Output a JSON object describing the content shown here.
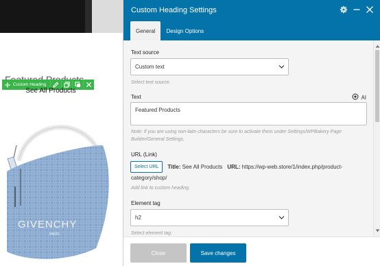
{
  "preview": {
    "heading_text": "Featured Products",
    "sub_text": "See All Products",
    "toolbar_label": "Custom Heading",
    "bag_brand_text": "GIVENCHY",
    "bag_sub_text": "PARIS"
  },
  "panel": {
    "title": "Custom Heading Settings",
    "tabs": [
      {
        "label": "General",
        "active": true
      },
      {
        "label": "Design Options",
        "active": false
      }
    ],
    "header_icons": [
      "gear-icon",
      "minimize-icon",
      "close-icon"
    ]
  },
  "fields": {
    "text_source": {
      "label": "Text source",
      "value": "Custom text",
      "hint": "Select text source."
    },
    "text": {
      "label": "Text",
      "value": "Featured Products",
      "ai_label": "AI",
      "hint_line1": "Note: If you are using non-latin characters be sure to activate them under Settings/WPBakery Page",
      "hint_line2": "Builder/General Settings."
    },
    "url": {
      "label": "URL (Link)",
      "button_label": "Select URL",
      "title_label": "Title:",
      "title_value": "See All Products",
      "url_label": "URL:",
      "url_value_line1": "https://wp-web.store/1/index.php/product-",
      "url_value_line2": "category/shop/",
      "hint": "Add link to custom heading."
    },
    "element_tag": {
      "label": "Element tag",
      "value": "h2",
      "hint": "Select element tag."
    }
  },
  "footer": {
    "close_label": "Close",
    "save_label": "Save changes"
  },
  "colors": {
    "header_blue": "#0473aa",
    "toolbar_green": "#3ab54a",
    "close_gray": "#c5c5c5",
    "bag_denim": "#8eaed3"
  }
}
